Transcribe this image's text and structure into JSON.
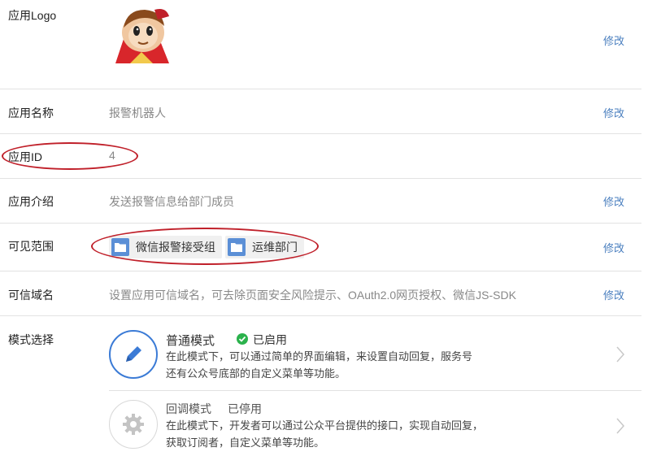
{
  "logo": {
    "label": "应用Logo",
    "edit": "修改"
  },
  "name": {
    "label": "应用名称",
    "value": "报警机器人",
    "edit": "修改"
  },
  "app_id": {
    "label": "应用ID",
    "value": "4"
  },
  "intro": {
    "label": "应用介绍",
    "value": "发送报警信息给部门成员",
    "edit": "修改"
  },
  "visibility": {
    "label": "可见范围",
    "tags": [
      "微信报警接受组",
      "运维部门"
    ],
    "edit": "修改"
  },
  "domain": {
    "label": "可信域名",
    "value": "设置应用可信域名，可去除页面安全风险提示、OAuth2.0网页授权、微信JS-SDK",
    "edit": "修改"
  },
  "modes": {
    "label": "模式选择",
    "items": [
      {
        "title": "普通模式",
        "status": "已启用",
        "desc1": "在此模式下，可以通过简单的界面编辑，来设置自动回复，服务号",
        "desc2": "还有公众号底部的自定义菜单等功能。"
      },
      {
        "title": "回调模式",
        "status": "已停用",
        "desc1": "在此模式下，开发者可以通过公众平台提供的接口，实现自动回复，",
        "desc2": "获取订阅者，自定义菜单等功能。"
      }
    ]
  },
  "colors": {
    "link": "#4a7fbf",
    "accent": "#3b7bd6",
    "enabled": "#2bb24c",
    "annotation": "#c0202a"
  }
}
